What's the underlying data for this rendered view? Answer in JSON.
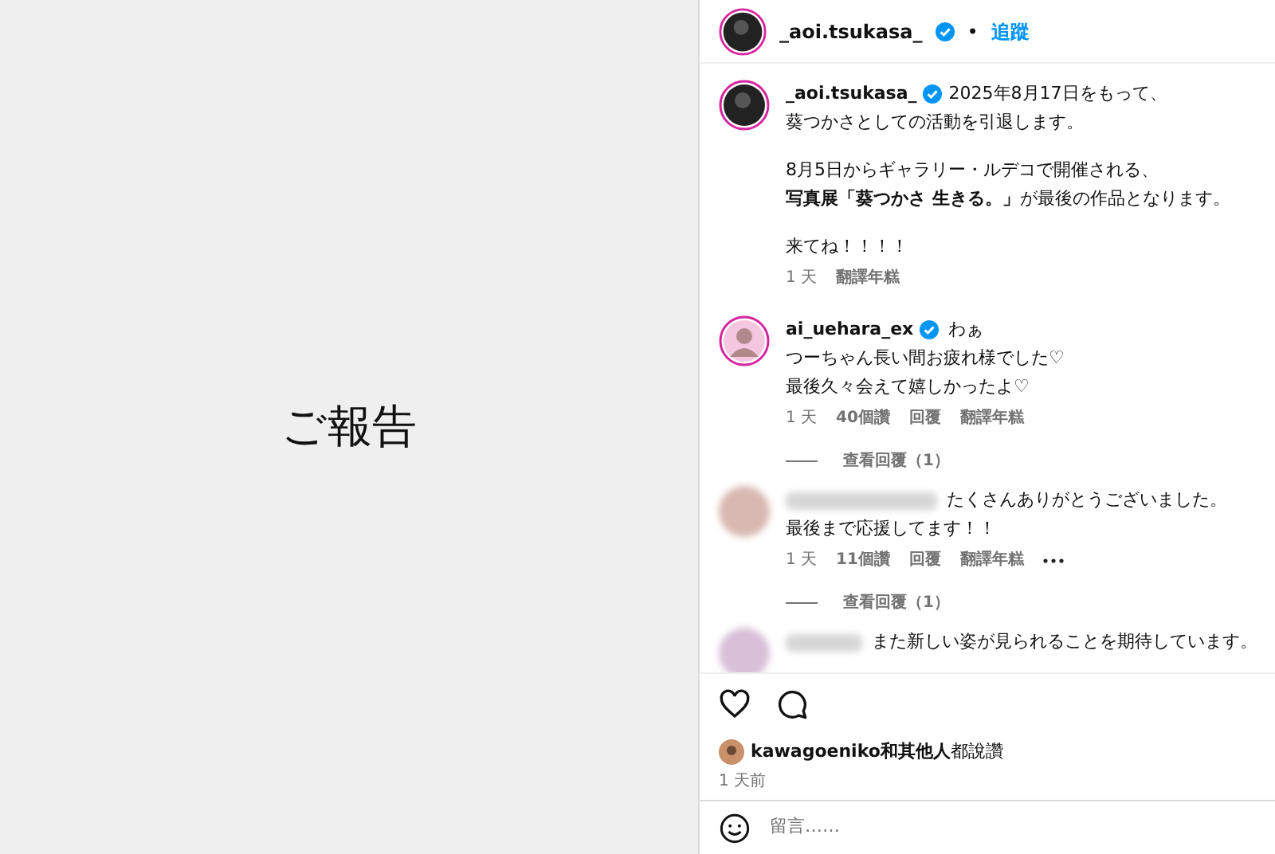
{
  "post_image": {
    "text": "ご報告"
  },
  "header": {
    "username": "_aoi.tsukasa_",
    "verified": true,
    "separator": "•",
    "follow": "追蹤"
  },
  "caption": {
    "username": "_aoi.tsukasa_",
    "verified": true,
    "paragraphs": [
      [
        "2025年8月17日をもって、",
        "葵つかさとしての活動を引退します。"
      ],
      [
        "8月5日からギャラリー・ルデコで開催される、",
        "**写真展「葵つかさ 生きる。」**が最後の作品となります。"
      ],
      [
        "来てね！！！！"
      ]
    ],
    "time": "1 天",
    "translate": "翻譯年糕"
  },
  "comments": [
    {
      "username": "ai_uehara_ex",
      "verified": true,
      "blurred": false,
      "lines": [
        "わぁ",
        "つーちゃん長い間お疲れ様でした♡",
        "最後久々会えて嬉しかったよ♡"
      ],
      "time": "1 天",
      "likes": "40個讚",
      "reply": "回覆",
      "translate": "翻譯年糕",
      "more": false,
      "view_replies": "查看回覆（1）"
    },
    {
      "blurred": true,
      "verified": false,
      "lines": [
        "たくさんありがとうございました。",
        "最後まで応援してます！！"
      ],
      "time": "1 天",
      "likes": "11個讚",
      "reply": "回覆",
      "translate": "翻譯年糕",
      "more": true,
      "view_replies": "查看回覆（1）"
    },
    {
      "blurred": true,
      "verified": false,
      "lines": [
        "また新しい姿が見られることを期待しています。"
      ]
    }
  ],
  "likes": {
    "text": "**kawagoeniko和其他人**都說讚",
    "time": "1 天前"
  },
  "comment_field": {
    "placeholder": "留言……"
  }
}
